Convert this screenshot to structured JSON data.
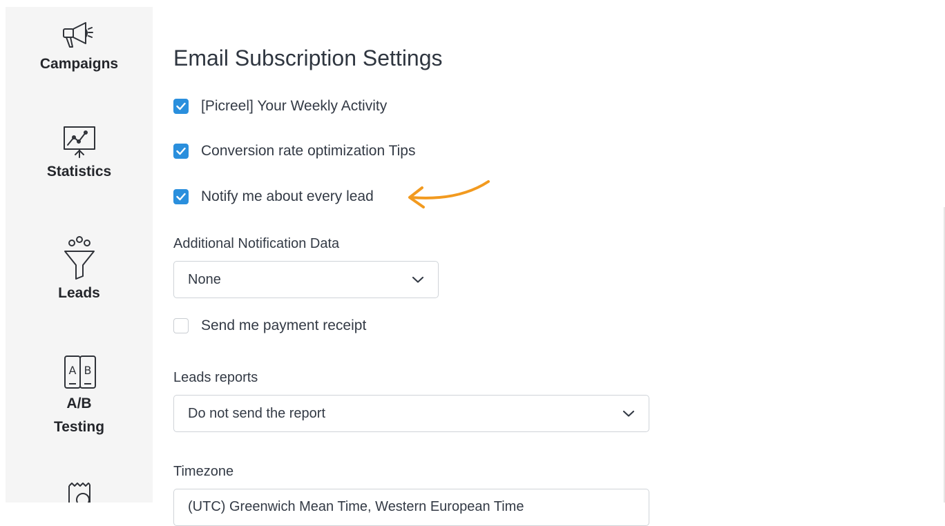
{
  "sidebar": {
    "items": [
      {
        "label": "Campaigns",
        "icon": "megaphone-icon"
      },
      {
        "label": "Statistics",
        "icon": "presentation-chart-icon"
      },
      {
        "label": "Leads",
        "icon": "funnel-icon"
      },
      {
        "label_line1": "A/B",
        "label_line2": "Testing",
        "icon": "ab-test-icon"
      },
      {
        "icon": "billing-icon"
      }
    ]
  },
  "main": {
    "title": "Email Subscription Settings",
    "checkboxes": [
      {
        "label": "[Picreel] Your Weekly Activity",
        "checked": true
      },
      {
        "label": "Conversion rate optimization Tips",
        "checked": true
      },
      {
        "label": "Notify me about every lead",
        "checked": true
      },
      {
        "label": "Send me payment receipt",
        "checked": false
      }
    ],
    "additional_notification": {
      "label": "Additional Notification Data",
      "value": "None"
    },
    "leads_reports": {
      "label": "Leads reports",
      "value": "Do not send the report"
    },
    "timezone": {
      "label": "Timezone",
      "value": "(UTC) Greenwich Mean Time, Western European Time"
    }
  },
  "colors": {
    "checkbox_accent": "#2a8fdd",
    "annotation_arrow": "#f29a1f",
    "sidebar_bg": "#f5f5f5"
  }
}
